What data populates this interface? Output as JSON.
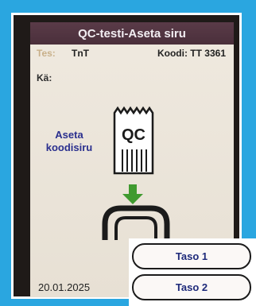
{
  "title": "QC-testi-Aseta siru",
  "test_label": "Tes:",
  "test_value": "TnT",
  "code": "Koodi: TT 3361",
  "ka_label": "Kä:",
  "instruction_line1": "Aseta",
  "instruction_line2": "koodisiru",
  "chip_text": "QC",
  "date": "20.01.2025",
  "buttons": {
    "taso1": "Taso 1",
    "taso2": "Taso 2"
  },
  "colors": {
    "background": "#2aa6e0",
    "titlebar": "#4a2f3b",
    "instruction": "#2a2f8e",
    "arrow": "#3f9a2f"
  }
}
